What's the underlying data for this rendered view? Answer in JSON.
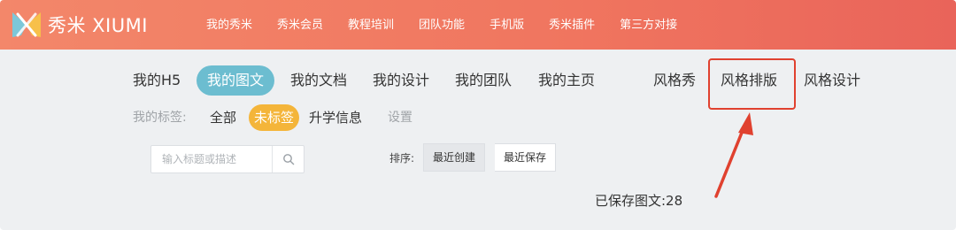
{
  "brand": {
    "name": "秀米 XIUMI"
  },
  "top_nav": [
    "我的秀米",
    "秀米会员",
    "教程培训",
    "团队功能",
    "手机版",
    "秀米插件",
    "第三方对接"
  ],
  "tabs": [
    {
      "label": "我的H5",
      "active": false
    },
    {
      "label": "我的图文",
      "active": true
    },
    {
      "label": "我的文档",
      "active": false
    },
    {
      "label": "我的设计",
      "active": false
    },
    {
      "label": "我的团队",
      "active": false
    },
    {
      "label": "我的主页",
      "active": false
    },
    {
      "label": "风格秀",
      "active": false
    },
    {
      "label": "风格排版",
      "active": false,
      "highlighted": true
    },
    {
      "label": "风格设计",
      "active": false
    }
  ],
  "labels": {
    "prefix": "我的标签:",
    "items": [
      {
        "label": "全部",
        "active": false
      },
      {
        "label": "未标签",
        "active": true
      },
      {
        "label": "升学信息",
        "active": false
      }
    ],
    "settings": "设置"
  },
  "search": {
    "placeholder": "输入标题或描述",
    "value": ""
  },
  "sort": {
    "label": "排序:",
    "options": [
      {
        "label": "最近创建",
        "active": true
      },
      {
        "label": "最近保存",
        "active": false
      }
    ]
  },
  "saved_count": "已保存图文:28",
  "colors": {
    "topbar": "#f0755f",
    "tab_active": "#6cbdd0",
    "label_active": "#f4b53a",
    "annotation": "#e0412f"
  }
}
